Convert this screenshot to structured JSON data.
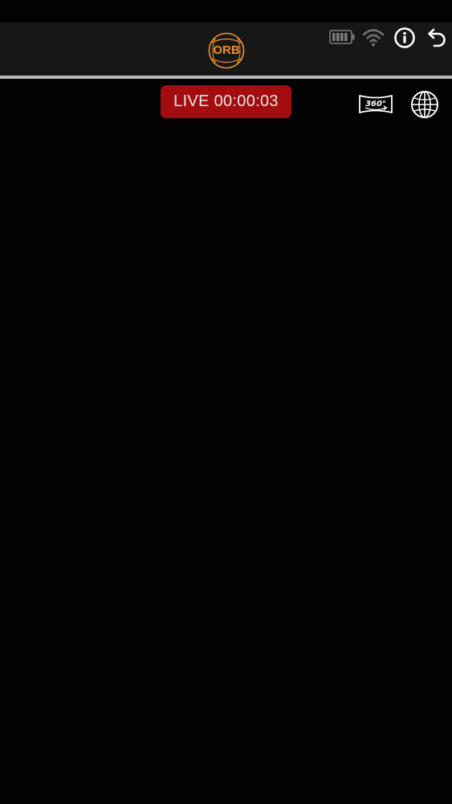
{
  "header": {
    "logo_text": "ORB",
    "logo_color": "#f0902a",
    "battery_icon": "battery-icon",
    "wifi_icon": "wifi-icon",
    "info_icon": "info-icon",
    "back_icon": "back-arrow-icon"
  },
  "live": {
    "label": "LIVE 00:00:03",
    "color": "#a40d10"
  },
  "controls": {
    "view360_icon": "360-view-icon",
    "globe_icon": "globe-icon"
  }
}
